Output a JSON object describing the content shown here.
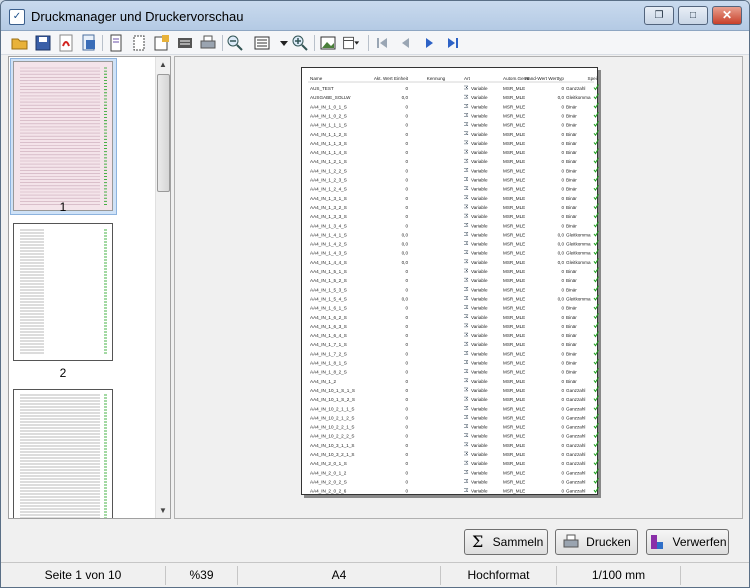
{
  "window": {
    "title": "Druckmanager und Druckervorschau"
  },
  "toolbar": {
    "icons": [
      "open-folder-icon",
      "save-icon",
      "pdf-icon",
      "export-icon",
      "page-setup-icon",
      "new-page-icon",
      "print-setup-icon",
      "printer-config-icon",
      "print-icon",
      "zoom-out-icon",
      "view-mode-icon",
      "dropdown-icon",
      "zoom-in-icon",
      "image-icon",
      "layout-icon",
      "first-page-icon",
      "prev-page-icon",
      "next-page-icon",
      "last-page-icon"
    ]
  },
  "thumbnails": [
    {
      "label": "1",
      "selected": true
    },
    {
      "label": "2",
      "selected": false
    },
    {
      "label": "",
      "selected": false
    }
  ],
  "report": {
    "headers": [
      "Name",
      "Akt. Wert Einheit",
      "Kennung",
      "Art",
      "Autom.Gerät",
      "Hand-Wert Werttyp",
      "Spei."
    ],
    "rows": [
      [
        "AUS_TEST",
        "0",
        "Variable",
        "MSR_MLE",
        "0",
        "Ganzzahl"
      ],
      [
        "AUSGABE_SOLLW",
        "0,0",
        "Variable",
        "MSR_MLE",
        "0,0",
        "Gleitkomma"
      ],
      [
        "AA4_IN_1_0_1_S",
        "0",
        "Variable",
        "MSR_MLE",
        "0",
        "Binär"
      ],
      [
        "AA4_IN_1_0_2_S",
        "0",
        "Variable",
        "MSR_MLE",
        "0",
        "Binär"
      ],
      [
        "AA4_IN_1_1_1_S",
        "0",
        "Variable",
        "MSR_MLE",
        "0",
        "Binär"
      ],
      [
        "AA4_IN_1_1_2_S",
        "0",
        "Variable",
        "MSR_MLE",
        "0",
        "Binär"
      ],
      [
        "AA4_IN_1_1_3_S",
        "0",
        "Variable",
        "MSR_MLE",
        "0",
        "Binär"
      ],
      [
        "AA4_IN_1_1_4_S",
        "0",
        "Variable",
        "MSR_MLE",
        "0",
        "Binär"
      ],
      [
        "AA4_IN_1_2_1_S",
        "0",
        "Variable",
        "MSR_MLE",
        "0",
        "Binär"
      ],
      [
        "AA4_IN_1_2_2_S",
        "0",
        "Variable",
        "MSR_MLE",
        "0",
        "Binär"
      ],
      [
        "AA4_IN_1_2_3_S",
        "0",
        "Variable",
        "MSR_MLE",
        "0",
        "Binär"
      ],
      [
        "AA4_IN_1_2_4_S",
        "0",
        "Variable",
        "MSR_MLE",
        "0",
        "Binär"
      ],
      [
        "AA4_IN_1_3_1_S",
        "0",
        "Variable",
        "MSR_MLE",
        "0",
        "Binär"
      ],
      [
        "AA4_IN_1_3_2_S",
        "0",
        "Variable",
        "MSR_MLE",
        "0",
        "Binär"
      ],
      [
        "AA4_IN_1_3_3_S",
        "0",
        "Variable",
        "MSR_MLE",
        "0",
        "Binär"
      ],
      [
        "AA4_IN_1_3_4_S",
        "0",
        "Variable",
        "MSR_MLE",
        "0",
        "Binär"
      ],
      [
        "AA4_IN_1_4_1_S",
        "0,0",
        "Variable",
        "MSR_MLE",
        "0,0",
        "Gleitkomma"
      ],
      [
        "AA4_IN_1_4_2_S",
        "0,0",
        "Variable",
        "MSR_MLE",
        "0,0",
        "Gleitkomma"
      ],
      [
        "AA4_IN_1_4_3_S",
        "0,0",
        "Variable",
        "MSR_MLE",
        "0,0",
        "Gleitkomma"
      ],
      [
        "AA4_IN_1_4_4_S",
        "0,0",
        "Variable",
        "MSR_MLE",
        "0,0",
        "Gleitkomma"
      ],
      [
        "AA4_IN_1_5_1_S",
        "0",
        "Variable",
        "MSR_MLE",
        "0",
        "Binär"
      ],
      [
        "AA4_IN_1_5_2_S",
        "0",
        "Variable",
        "MSR_MLE",
        "0",
        "Binär"
      ],
      [
        "AA4_IN_1_5_3_S",
        "0",
        "Variable",
        "MSR_MLE",
        "0",
        "Binär"
      ],
      [
        "AA4_IN_1_5_4_S",
        "0,0",
        "Variable",
        "MSR_MLE",
        "0,0",
        "Gleitkomma"
      ],
      [
        "AA4_IN_1_6_1_S",
        "0",
        "Variable",
        "MSR_MLE",
        "0",
        "Binär"
      ],
      [
        "AA4_IN_1_6_2_S",
        "0",
        "Variable",
        "MSR_MLE",
        "0",
        "Binär"
      ],
      [
        "AA4_IN_1_6_3_S",
        "0",
        "Variable",
        "MSR_MLE",
        "0",
        "Binär"
      ],
      [
        "AA4_IN_1_6_4_S",
        "0",
        "Variable",
        "MSR_MLE",
        "0",
        "Binär"
      ],
      [
        "AA4_IN_1_7_1_S",
        "0",
        "Variable",
        "MSR_MLE",
        "0",
        "Binär"
      ],
      [
        "AA4_IN_1_7_2_S",
        "0",
        "Variable",
        "MSR_MLE",
        "0",
        "Binär"
      ],
      [
        "AA4_IN_1_8_1_S",
        "0",
        "Variable",
        "MSR_MLE",
        "0",
        "Binär"
      ],
      [
        "AA4_IN_1_8_2_S",
        "0",
        "Variable",
        "MSR_MLE",
        "0",
        "Binär"
      ],
      [
        "AA4_IN_1_2",
        "0",
        "Variable",
        "MSR_MLE",
        "0",
        "Binär"
      ],
      [
        "AA4_IN_10_1_S_1_S",
        "0",
        "Variable",
        "MSR_MLE",
        "0",
        "Ganzzahl"
      ],
      [
        "AA4_IN_10_1_S_2_S",
        "0",
        "Variable",
        "MSR_MLE",
        "0",
        "Ganzzahl"
      ],
      [
        "AA4_IN_10_2_1_1_S",
        "0",
        "Variable",
        "MSR_MLE",
        "0",
        "Ganzzahl"
      ],
      [
        "AA4_IN_10_2_1_2_S",
        "0",
        "Variable",
        "MSR_MLE",
        "0",
        "Ganzzahl"
      ],
      [
        "AA4_IN_10_2_2_1_S",
        "0",
        "Variable",
        "MSR_MLE",
        "0",
        "Ganzzahl"
      ],
      [
        "AA4_IN_10_2_2_2_S",
        "0",
        "Variable",
        "MSR_MLE",
        "0",
        "Ganzzahl"
      ],
      [
        "AA4_IN_10_3_1_1_S",
        "0",
        "Variable",
        "MSR_MLE",
        "0",
        "Ganzzahl"
      ],
      [
        "AA4_IN_10_3_2_1_S",
        "0",
        "Variable",
        "MSR_MLE",
        "0",
        "Ganzzahl"
      ],
      [
        "AA4_IN_2_0_1_S",
        "0",
        "Variable",
        "MSR_MLE",
        "0",
        "Ganzzahl"
      ],
      [
        "AA4_IN_2_0_1_2",
        "0",
        "Variable",
        "MSR_MLE",
        "0",
        "Ganzzahl"
      ],
      [
        "AA4_IN_2_0_2_S",
        "0",
        "Variable",
        "MSR_MLE",
        "0",
        "Ganzzahl"
      ],
      [
        "AA4_IN_2_0_2_6",
        "0",
        "Variable",
        "MSR_MLE",
        "0",
        "Ganzzahl"
      ]
    ]
  },
  "buttons": {
    "collect": "Sammeln",
    "print": "Drucken",
    "discard": "Verwerfen"
  },
  "statusbar": {
    "page": "Seite 1 von 10",
    "zoom": "%39",
    "format": "A4",
    "orientation": "Hochformat",
    "unit": "1/100 mm"
  },
  "colors": {
    "check": "#1aa01a",
    "accent": "#2e5da8"
  }
}
